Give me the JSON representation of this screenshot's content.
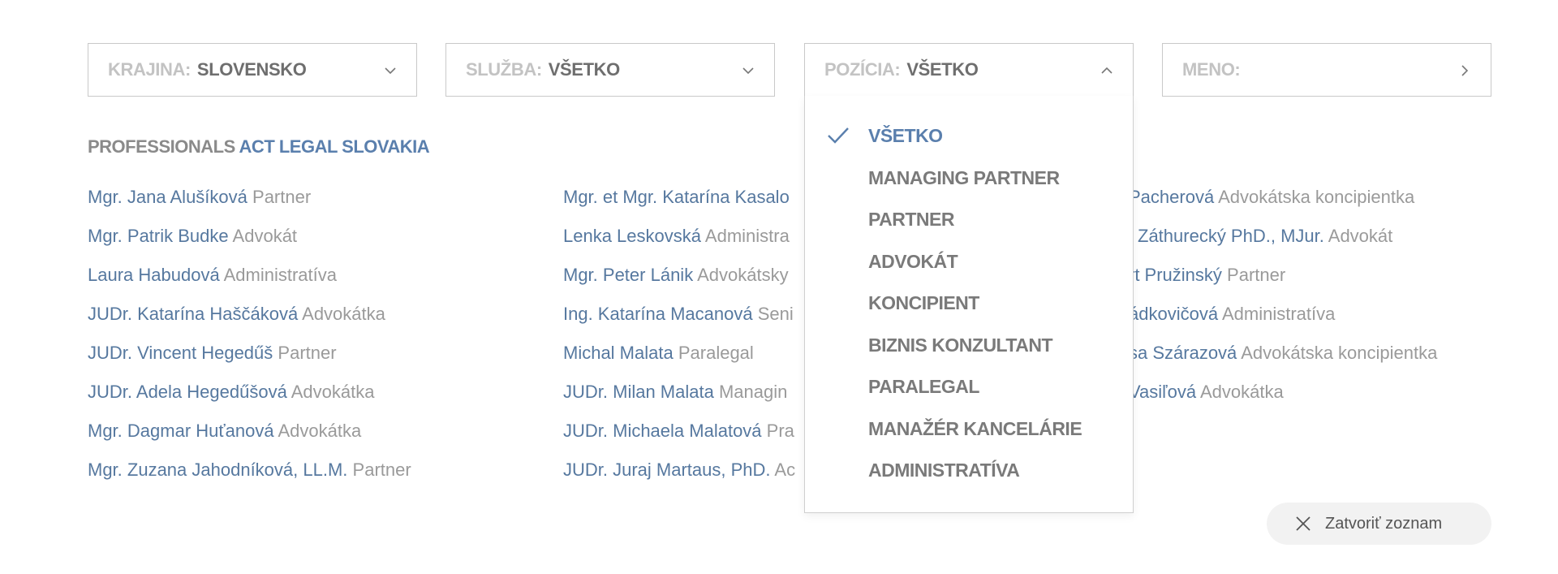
{
  "filters": {
    "krajina": {
      "label": "KRAJINA:",
      "value": "SLOVENSKO",
      "icon": "chevron-down-icon"
    },
    "sluzba": {
      "label": "SLUŽBA:",
      "value": "VŠETKO",
      "icon": "chevron-down-icon"
    },
    "pozicia": {
      "label": "POZÍCIA:",
      "value": "VŠETKO",
      "icon": "chevron-up-icon"
    },
    "meno": {
      "label": "MENO:",
      "value": "",
      "icon": "chevron-right-icon"
    }
  },
  "section": {
    "prefix": "PROFESSIONALS",
    "company": "ACT LEGAL SLOVAKIA"
  },
  "people_col1": [
    {
      "name": "Mgr. Jana Alušíková",
      "role": "Partner"
    },
    {
      "name": "Mgr. Patrik Budke",
      "role": "Advokát"
    },
    {
      "name": "Laura Habudová",
      "role": "Administratíva"
    },
    {
      "name": "JUDr. Katarína Haščáková",
      "role": "Advokátka"
    },
    {
      "name": "JUDr. Vincent Hegedűš",
      "role": "Partner"
    },
    {
      "name": "JUDr. Adela Hegedűšová",
      "role": "Advokátka"
    },
    {
      "name": "Mgr. Dagmar Huťanová",
      "role": "Advokátka"
    },
    {
      "name": "Mgr. Zuzana Jahodníková, LL.M.",
      "role": "Partner"
    }
  ],
  "people_col2": [
    {
      "name": "Mgr. et Mgr. Katarína Kasalo",
      "role": ""
    },
    {
      "name": "Lenka Leskovská",
      "role": "Administra"
    },
    {
      "name": "Mgr. Peter Lánik",
      "role": "Advokátsky"
    },
    {
      "name": "Ing. Katarína Macanová",
      "role": "Seni"
    },
    {
      "name": "Michal Malata",
      "role": "Paralegal"
    },
    {
      "name": "JUDr. Milan Malata",
      "role": "Managin"
    },
    {
      "name": "JUDr. Michaela Malatová",
      "role": "Pra"
    },
    {
      "name": "JUDr. Juraj Martaus, PhD.",
      "role": "Ac"
    }
  ],
  "people_col3": [
    {
      "name": "Pacherová",
      "role": "Advokátska koncipientka"
    },
    {
      "name": "l Záthurecký PhD., MJur.",
      "role": "Advokát"
    },
    {
      "name": "rt Pružinský",
      "role": "Partner"
    },
    {
      "name": "ádkovičová",
      "role": "Administratíva"
    },
    {
      "name": "sa Szárazová",
      "role": "Advokátska koncipientka"
    },
    {
      "name": "Vasiľová",
      "role": "Advokátka"
    }
  ],
  "dropdown": {
    "selected_icon": "check-icon",
    "options": [
      {
        "label": "VŠETKO",
        "selected": true
      },
      {
        "label": "MANAGING PARTNER",
        "selected": false
      },
      {
        "label": "PARTNER",
        "selected": false
      },
      {
        "label": "ADVOKÁT",
        "selected": false
      },
      {
        "label": "KONCIPIENT",
        "selected": false
      },
      {
        "label": "BIZNIS KONZULTANT",
        "selected": false
      },
      {
        "label": "PARALEGAL",
        "selected": false
      },
      {
        "label": "MANAŽÉR KANCELÁRIE",
        "selected": false
      },
      {
        "label": "ADMINISTRATÍVA",
        "selected": false
      }
    ]
  },
  "close_button": {
    "label": "Zatvoriť zoznam",
    "icon": "close-icon"
  },
  "colors": {
    "accent": "#5a7fad",
    "name": "#56789f",
    "role": "#9a9a9a",
    "label": "#c3c3c3",
    "value": "#6e6e6e",
    "border": "#c9c9c9"
  }
}
